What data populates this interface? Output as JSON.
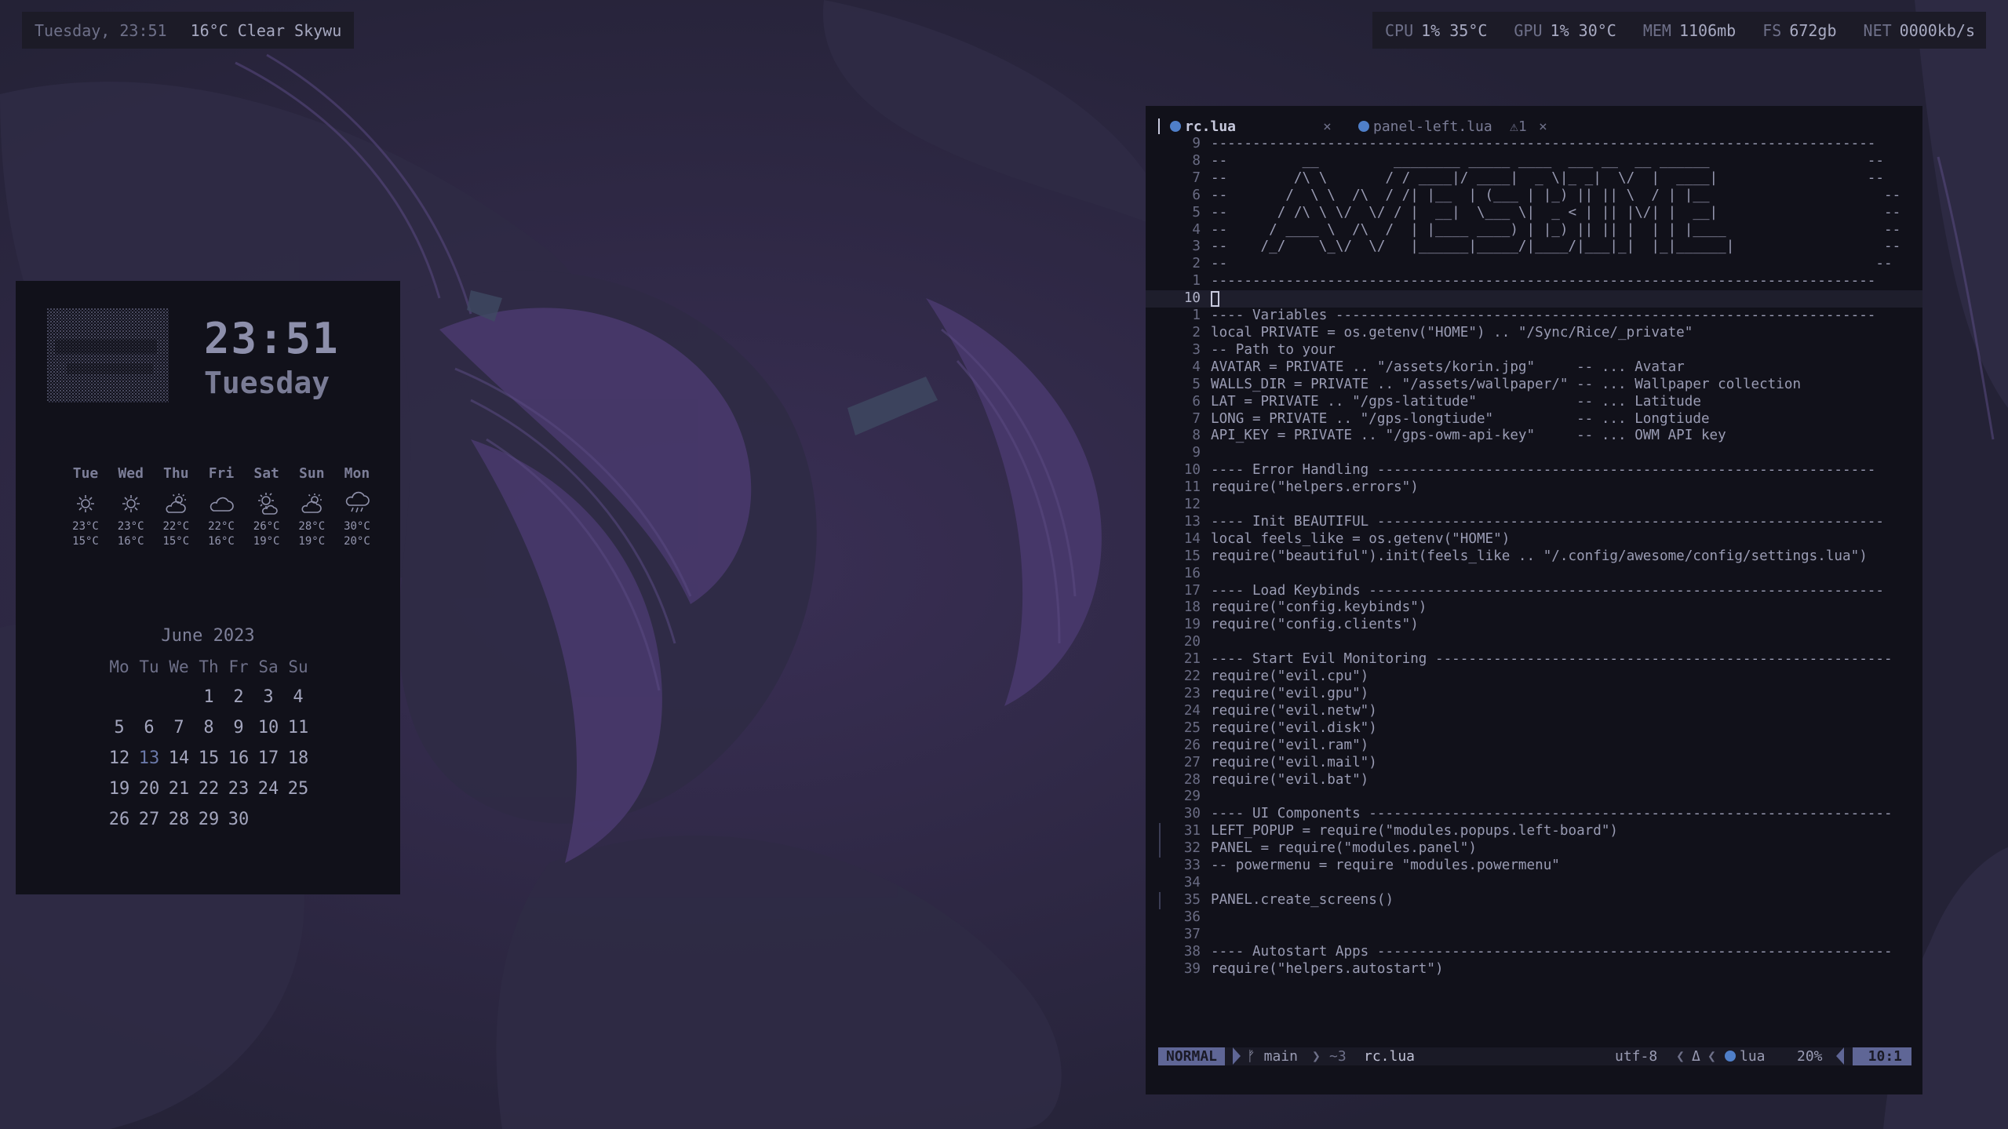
{
  "topbar_left": {
    "datetime": "Tuesday, 23:51",
    "weather": "16°C Clear Skywu"
  },
  "topbar_right": [
    {
      "key": "CPU",
      "value": "1% 35°C"
    },
    {
      "key": "GPU",
      "value": "1% 30°C"
    },
    {
      "key": "MEM",
      "value": "1106mb"
    },
    {
      "key": "FS",
      "value": "672gb"
    },
    {
      "key": "NET",
      "value": "0000kb/s"
    }
  ],
  "clock": {
    "time": "23:51",
    "day": "Tuesday"
  },
  "forecast": [
    {
      "day": "Tue",
      "icon": "sun-icon",
      "hi": "23°C",
      "lo": "15°C"
    },
    {
      "day": "Wed",
      "icon": "sun-icon",
      "hi": "23°C",
      "lo": "16°C"
    },
    {
      "day": "Thu",
      "icon": "cloud-sun-icon",
      "hi": "22°C",
      "lo": "15°C"
    },
    {
      "day": "Fri",
      "icon": "cloud-icon",
      "hi": "22°C",
      "lo": "16°C"
    },
    {
      "day": "Sat",
      "icon": "sun-cloud-icon",
      "hi": "26°C",
      "lo": "19°C"
    },
    {
      "day": "Sun",
      "icon": "cloud-sun-icon",
      "hi": "28°C",
      "lo": "19°C"
    },
    {
      "day": "Mon",
      "icon": "cloud-rain-icon",
      "hi": "30°C",
      "lo": "20°C"
    }
  ],
  "calendar": {
    "title": "June 2023",
    "weekdays": [
      "Mo",
      "Tu",
      "We",
      "Th",
      "Fr",
      "Sa",
      "Su"
    ],
    "first_weekday_index": 3,
    "days": 30,
    "today": 13
  },
  "editor": {
    "tab_active": "rc.lua",
    "tab_active_close": "×",
    "tab_other": "panel-left.lua",
    "tab_other_warn": "⚠1",
    "tab_other_close": "×",
    "lines": [
      {
        "n": "9",
        "t": "--------------------------------------------------------------------------------"
      },
      {
        "n": "8",
        "t": "--         __         ________ _____ ____  ___ __  __ ______                   --"
      },
      {
        "n": "7",
        "t": "--        /\\ \\       / / ____|/ ____|  _ \\|_ _|  \\/  |  ____|                  --"
      },
      {
        "n": "6",
        "t": "--       /  \\ \\  /\\  / /| |__  | (___ | |_) || || \\  / | |__                     --"
      },
      {
        "n": "5",
        "t": "--      / /\\ \\ \\/  \\/ / |  __|  \\___ \\|  _ < | || |\\/| |  __|                    --"
      },
      {
        "n": "4",
        "t": "--     / ____ \\  /\\  /  | |____ ____) | |_) || || |  | | |____                   --"
      },
      {
        "n": "3",
        "t": "--    /_/    \\_\\/  \\/   |______|_____/|____/|___|_|  |_|______|                  --"
      },
      {
        "n": "2",
        "t": "--                                                                              --"
      },
      {
        "n": "1",
        "t": "--------------------------------------------------------------------------------"
      },
      {
        "n": "10",
        "t": "",
        "cur": true
      },
      {
        "n": "1",
        "t": "---- Variables -----------------------------------------------------------------"
      },
      {
        "n": "2",
        "t": "local PRIVATE = os.getenv(\"HOME\") .. \"/Sync/Rice/_private\""
      },
      {
        "n": "3",
        "t": "-- Path to your"
      },
      {
        "n": "4",
        "t": "AVATAR = PRIVATE .. \"/assets/korin.jpg\"     -- ... Avatar"
      },
      {
        "n": "5",
        "t": "WALLS_DIR = PRIVATE .. \"/assets/wallpaper/\" -- ... Wallpaper collection"
      },
      {
        "n": "6",
        "t": "LAT = PRIVATE .. \"/gps-latitude\"            -- ... Latitude"
      },
      {
        "n": "7",
        "t": "LONG = PRIVATE .. \"/gps-longtiude\"          -- ... Longtiude"
      },
      {
        "n": "8",
        "t": "API_KEY = PRIVATE .. \"/gps-owm-api-key\"     -- ... OWM API key"
      },
      {
        "n": "9",
        "t": ""
      },
      {
        "n": "10",
        "t": "---- Error Handling ------------------------------------------------------------"
      },
      {
        "n": "11",
        "t": "require(\"helpers.errors\")"
      },
      {
        "n": "12",
        "t": ""
      },
      {
        "n": "13",
        "t": "---- Init BEAUTIFUL -------------------------------------------------------------"
      },
      {
        "n": "14",
        "t": "local feels_like = os.getenv(\"HOME\")"
      },
      {
        "n": "15",
        "t": "require(\"beautiful\").init(feels_like .. \"/.config/awesome/config/settings.lua\")"
      },
      {
        "n": "16",
        "t": ""
      },
      {
        "n": "17",
        "t": "---- Load Keybinds --------------------------------------------------------------"
      },
      {
        "n": "18",
        "t": "require(\"config.keybinds\")"
      },
      {
        "n": "19",
        "t": "require(\"config.clients\")"
      },
      {
        "n": "20",
        "t": ""
      },
      {
        "n": "21",
        "t": "---- Start Evil Monitoring -------------------------------------------------------"
      },
      {
        "n": "22",
        "t": "require(\"evil.cpu\")"
      },
      {
        "n": "23",
        "t": "require(\"evil.gpu\")"
      },
      {
        "n": "24",
        "t": "require(\"evil.netw\")"
      },
      {
        "n": "25",
        "t": "require(\"evil.disk\")"
      },
      {
        "n": "26",
        "t": "require(\"evil.ram\")"
      },
      {
        "n": "27",
        "t": "require(\"evil.mail\")"
      },
      {
        "n": "28",
        "t": "require(\"evil.bat\")"
      },
      {
        "n": "29",
        "t": ""
      },
      {
        "n": "30",
        "t": "---- UI Components ---------------------------------------------------------------"
      },
      {
        "n": "31",
        "t": "LEFT_POPUP = require(\"modules.popups.left-board\")",
        "gutter": true
      },
      {
        "n": "32",
        "t": "PANEL = require(\"modules.panel\")",
        "gutter": true
      },
      {
        "n": "33",
        "t": "-- powermenu = require \"modules.powermenu\""
      },
      {
        "n": "34",
        "t": ""
      },
      {
        "n": "35",
        "t": "PANEL.create_screens()",
        "gutter": true
      },
      {
        "n": "36",
        "t": ""
      },
      {
        "n": "37",
        "t": ""
      },
      {
        "n": "38",
        "t": "---- Autostart Apps --------------------------------------------------------------"
      },
      {
        "n": "39",
        "t": "require(\"helpers.autostart\")"
      }
    ],
    "status": {
      "mode": "NORMAL",
      "branch": "ᚠ main",
      "sep1": "❯",
      "changes": "~3",
      "file": "rc.lua",
      "encoding": "utf-8",
      "sep2": "❮",
      "os_glyph": "Δ",
      "sep3": "❮",
      "filetype": "lua",
      "percent": "20%",
      "position": "10:1"
    }
  }
}
